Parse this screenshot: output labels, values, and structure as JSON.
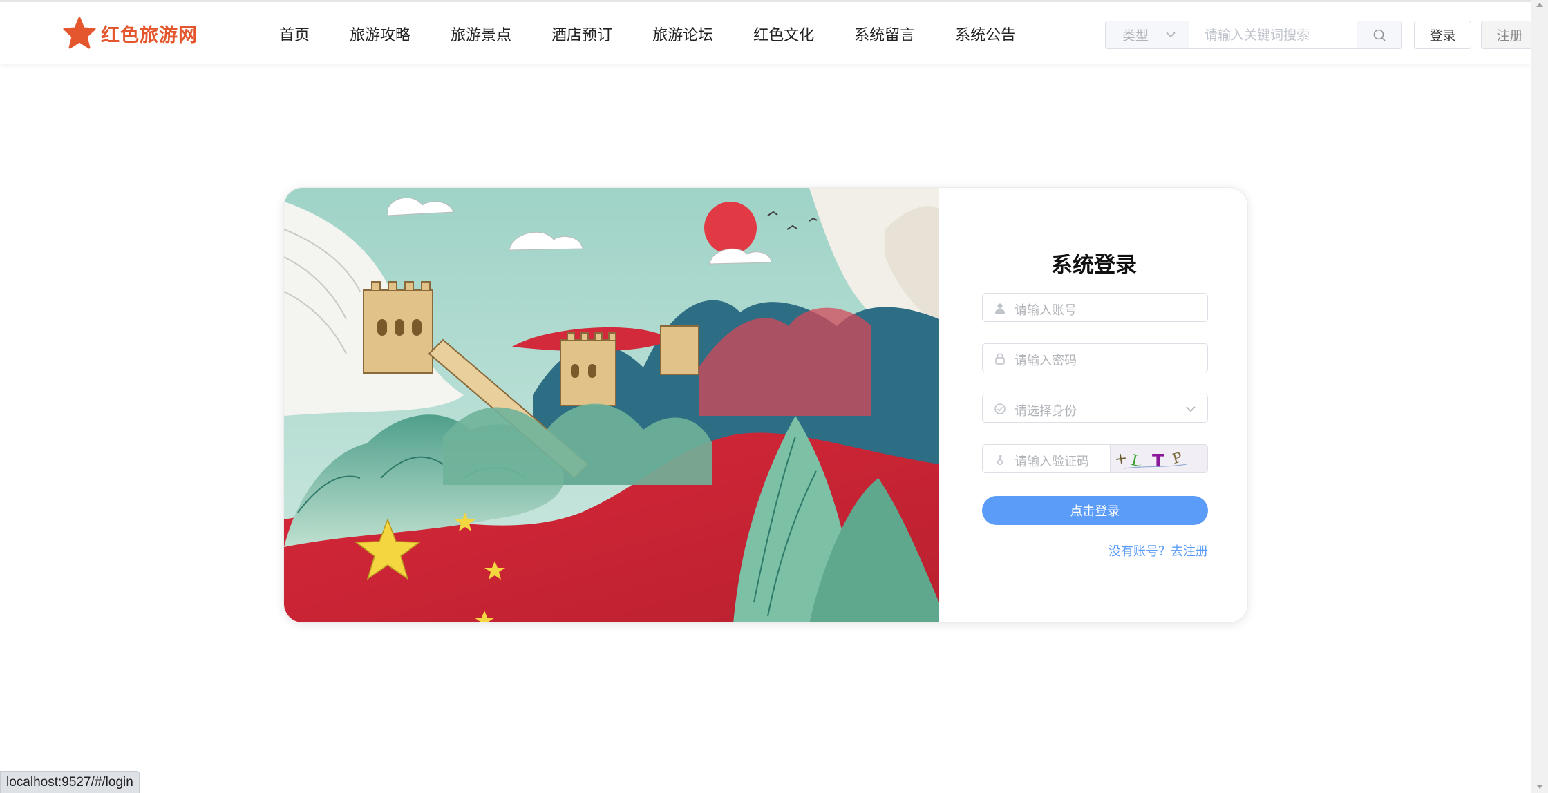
{
  "brand": {
    "name": "红色旅游网",
    "accent": "#e4572e"
  },
  "nav": {
    "items": [
      "首页",
      "旅游攻略",
      "旅游景点",
      "酒店预订",
      "旅游论坛",
      "红色文化",
      "系统留言",
      "系统公告"
    ]
  },
  "search": {
    "type_placeholder": "类型",
    "placeholder": "请输入关键词搜索",
    "icon": "search-icon"
  },
  "header_buttons": {
    "login": "登录",
    "register": "注册"
  },
  "login_form": {
    "title": "系统登录",
    "account_placeholder": "请输入账号",
    "password_placeholder": "请输入密码",
    "role_placeholder": "请选择身份",
    "captcha_placeholder": "请输入验证码",
    "captcha_text": "+LTP",
    "submit_label": "点击登录",
    "register_link": "没有账号？去注册",
    "primary_color": "#5a9cf8"
  },
  "status_bar": {
    "url": "localhost:9527/#/login"
  }
}
